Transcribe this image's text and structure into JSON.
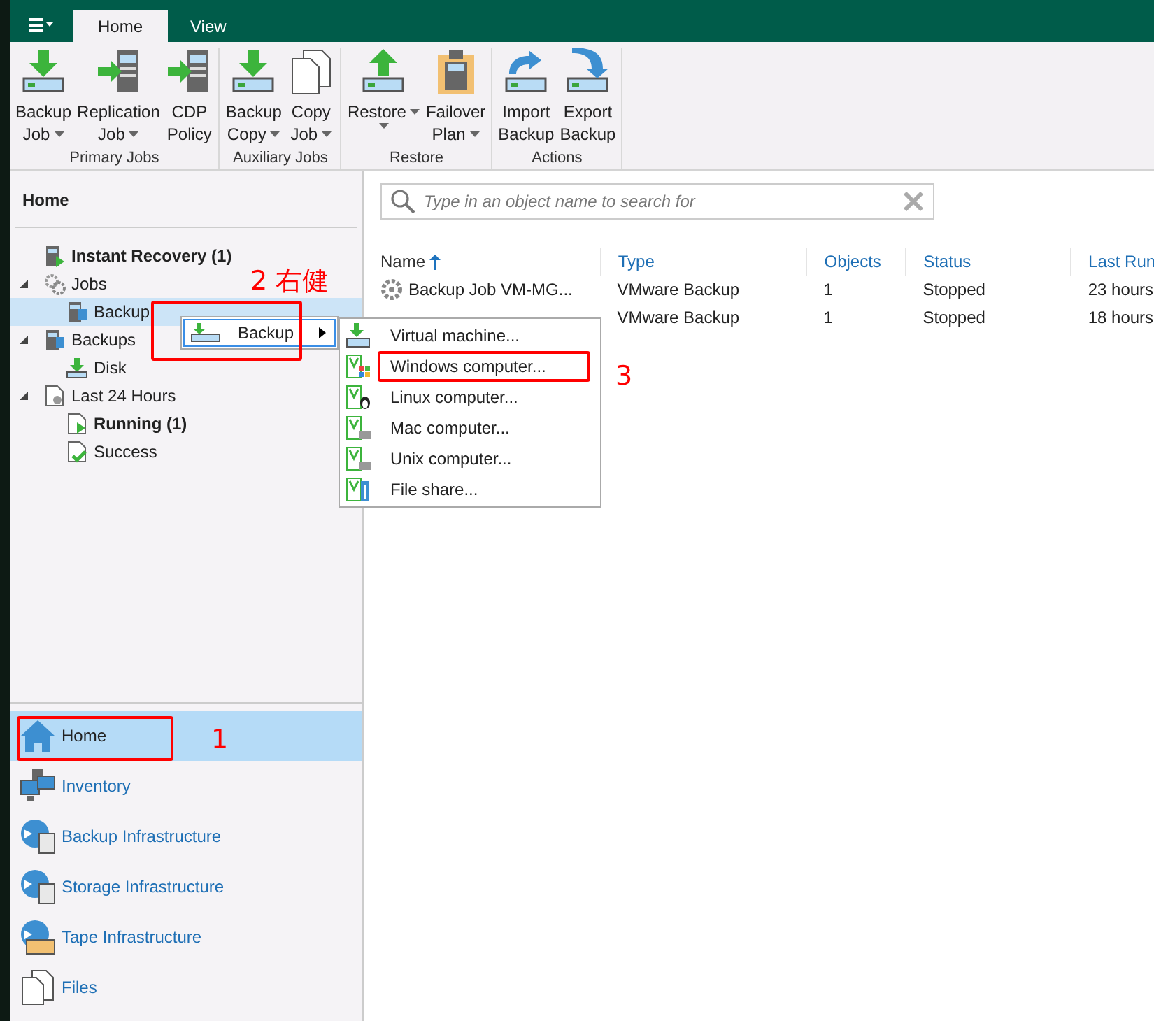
{
  "tabs": [
    {
      "label": "Home",
      "selected": true
    },
    {
      "label": "View",
      "selected": false
    }
  ],
  "ribbon_groups": [
    {
      "label": "Primary Jobs",
      "buttons": [
        {
          "kind": "backup",
          "lines": [
            "Backup",
            "Job"
          ],
          "dropdown": true
        },
        {
          "kind": "replication",
          "lines": [
            "Replication",
            "Job"
          ],
          "dropdown": true
        },
        {
          "kind": "cdp",
          "lines": [
            "CDP",
            "Policy"
          ],
          "dropdown": false
        }
      ]
    },
    {
      "label": "Auxiliary Jobs",
      "buttons": [
        {
          "kind": "backup_copy",
          "lines": [
            "Backup",
            "Copy"
          ],
          "dropdown": true
        },
        {
          "kind": "copy_job",
          "lines": [
            "Copy",
            "Job"
          ],
          "dropdown": true
        }
      ]
    },
    {
      "label": "Restore",
      "buttons": [
        {
          "kind": "restore",
          "lines": [
            "Restore"
          ],
          "dropdown": true
        },
        {
          "kind": "failover",
          "lines": [
            "Failover",
            "Plan"
          ],
          "dropdown": true
        }
      ]
    },
    {
      "label": "Actions",
      "buttons": [
        {
          "kind": "import",
          "lines": [
            "Import",
            "Backup"
          ],
          "dropdown": false
        },
        {
          "kind": "export",
          "lines": [
            "Export",
            "Backup"
          ],
          "dropdown": false
        }
      ]
    }
  ],
  "sidebar": {
    "title": "Home",
    "tree": [
      {
        "label": "Instant Recovery (1)",
        "kind": "instant",
        "bold": true,
        "selected": false
      },
      {
        "label": "Jobs",
        "kind": "jobs",
        "bold": false,
        "selected": false,
        "expanded": true,
        "children": [
          {
            "label": "Backup",
            "kind": "backup_job",
            "bold": false,
            "selected": true
          }
        ]
      },
      {
        "label": "Backups",
        "kind": "backups",
        "bold": false,
        "selected": false,
        "expanded": true,
        "children": [
          {
            "label": "Disk",
            "kind": "disk",
            "bold": false,
            "selected": false
          }
        ]
      },
      {
        "label": "Last 24 Hours",
        "kind": "last24",
        "bold": false,
        "selected": false,
        "expanded": true,
        "children": [
          {
            "label": "Running (1)",
            "kind": "running",
            "bold": true,
            "selected": false
          },
          {
            "label": "Success",
            "kind": "success",
            "bold": false,
            "selected": false
          }
        ]
      }
    ],
    "nav": [
      {
        "label": "Home",
        "kind": "home",
        "selected": true
      },
      {
        "label": "Inventory",
        "kind": "inventory",
        "selected": false
      },
      {
        "label": "Backup Infrastructure",
        "kind": "backup_infra",
        "selected": false
      },
      {
        "label": "Storage Infrastructure",
        "kind": "storage_infra",
        "selected": false
      },
      {
        "label": "Tape Infrastructure",
        "kind": "tape_infra",
        "selected": false
      },
      {
        "label": "Files",
        "kind": "files",
        "selected": false
      }
    ]
  },
  "search": {
    "placeholder": "Type in an object name to search for"
  },
  "table": {
    "columns": [
      {
        "label": "Name",
        "sorted": true
      },
      {
        "label": "Type",
        "sorted": false
      },
      {
        "label": "Objects",
        "sorted": false
      },
      {
        "label": "Status",
        "sorted": false
      },
      {
        "label": "Last Run",
        "sorted": false
      }
    ],
    "rows": [
      {
        "cells": [
          "Backup Job VM-MG...",
          "VMware Backup",
          "1",
          "Stopped",
          "23 hours"
        ]
      },
      {
        "cells": [
          "",
          "VMware Backup",
          "1",
          "Stopped",
          "18 hours"
        ]
      }
    ]
  },
  "context_menu": {
    "label": "Backup",
    "submenu": [
      {
        "label": "Virtual machine...",
        "kind": "vm"
      },
      {
        "label": "Windows computer...",
        "kind": "windows"
      },
      {
        "label": "Linux computer...",
        "kind": "linux"
      },
      {
        "label": "Mac computer...",
        "kind": "mac"
      },
      {
        "label": "Unix computer...",
        "kind": "unix"
      },
      {
        "label": "File share...",
        "kind": "share"
      }
    ]
  },
  "annotations": [
    {
      "text": "1"
    },
    {
      "text": "2 右健"
    },
    {
      "text": "3"
    }
  ]
}
